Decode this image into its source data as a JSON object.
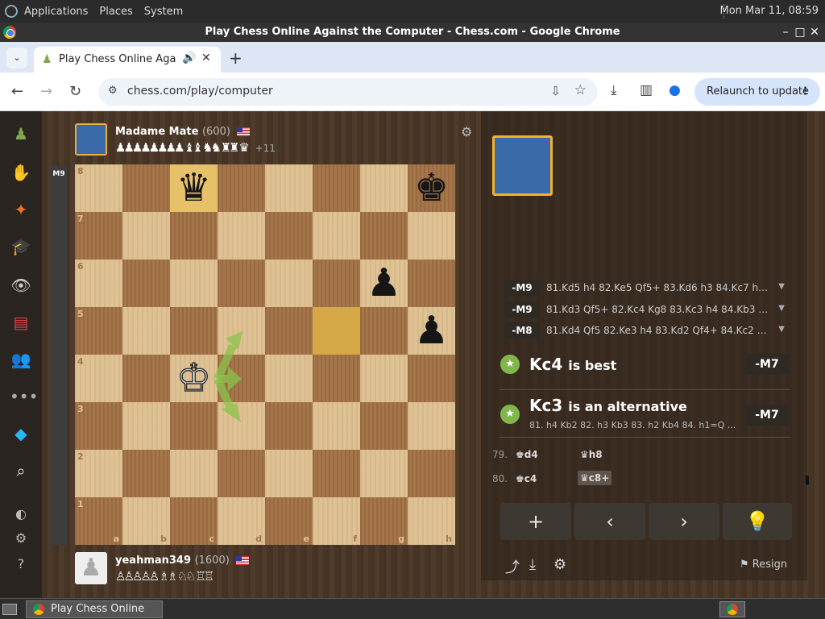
{
  "os": {
    "menus": [
      "Applications",
      "Places",
      "System"
    ],
    "clock": "Mon Mar 11, 08:59"
  },
  "window": {
    "title": "Play Chess Online Against the Computer - Chess.com - Google Chrome"
  },
  "browser": {
    "tab_title": "Play Chess Online Against the Computer",
    "url": "chess.com/play/computer",
    "relaunch_label": "Relaunch to update"
  },
  "opponent": {
    "name": "Madame Mate",
    "rating": "(600)",
    "captured_bonus": "+11",
    "captured": "♟♟♟♟♟♟♟♟ ♝♝ ♞♞ ♜♜ ♛"
  },
  "player": {
    "name": "yeahman349",
    "rating": "(1600)",
    "captured": "♙♙♙♙♙ ♗♗ ♘♘ ♖♖"
  },
  "eval_label": "M9",
  "board": {
    "files": [
      "a",
      "b",
      "c",
      "d",
      "e",
      "f",
      "g",
      "h"
    ],
    "ranks": [
      "8",
      "7",
      "6",
      "5",
      "4",
      "3",
      "2",
      "1"
    ],
    "pieces": [
      {
        "sq": "c8",
        "glyph": "♛",
        "color": "b"
      },
      {
        "sq": "h8",
        "glyph": "♚",
        "color": "b"
      },
      {
        "sq": "g6",
        "glyph": "♟",
        "color": "b"
      },
      {
        "sq": "h5",
        "glyph": "♟",
        "color": "b"
      },
      {
        "sq": "c4",
        "glyph": "♔",
        "color": "w"
      }
    ],
    "highlight": [
      "c8"
    ],
    "highlight2": [
      "f5"
    ]
  },
  "engine_lines": [
    {
      "eval": "-M9",
      "moves": "81.Kd5 h4 82.Ke5 Qf5+ 83.Kd6 h3 84.Kc7 h2 ..."
    },
    {
      "eval": "-M9",
      "moves": "81.Kd3 Qf5+ 82.Kc4 Kg8 83.Kc3 h4 84.Kb3 h3..."
    },
    {
      "eval": "-M8",
      "moves": "81.Kd4 Qf5 82.Ke3 h4 83.Kd2 Qf4+ 84.Kc2 h3..."
    }
  ],
  "best": {
    "move": "Kc4",
    "text": "is best",
    "eval": "-M7"
  },
  "alt": {
    "move": "Kc3",
    "text": "is an alternative",
    "line": "81. h4 Kb2 82. h3 Kb3 83. h2 Kb4 84. h1=Q ...",
    "eval": "-M7"
  },
  "history": [
    {
      "num": "79.",
      "white": "♚d4",
      "black": "♛h8"
    },
    {
      "num": "80.",
      "white": "♚c4",
      "black": "♛c8+"
    }
  ],
  "controls": {
    "add": "+",
    "prev": "‹",
    "next": "›"
  },
  "resign_label": "Resign",
  "taskbar": {
    "window_label": "Play Chess Online A..."
  }
}
